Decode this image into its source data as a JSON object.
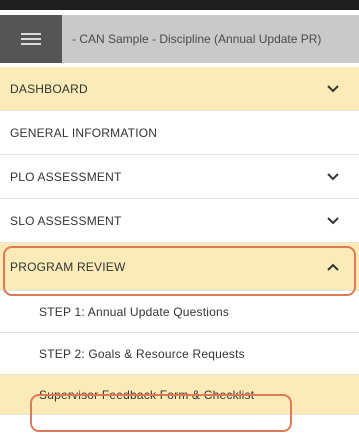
{
  "header": {
    "menu_icon": "hamburger-icon",
    "title": "- CAN Sample - Discipline (Annual Update PR)"
  },
  "nav": {
    "dashboard": {
      "label": "DASHBOARD",
      "icon": "chevron-down-icon"
    },
    "general_information": {
      "label": "GENERAL INFORMATION"
    },
    "plo_assessment": {
      "label": "PLO ASSESSMENT",
      "icon": "chevron-down-icon"
    },
    "slo_assessment": {
      "label": "SLO ASSESSMENT",
      "icon": "chevron-down-icon"
    },
    "program_review": {
      "label": "PROGRAM REVIEW",
      "icon": "chevron-up-icon",
      "expanded": true,
      "items": [
        {
          "label": "STEP 1: Annual Update Questions"
        },
        {
          "label": "STEP 2: Goals & Resource Requests"
        },
        {
          "label": "Supervisor Feedback Form & Checklist",
          "active": true
        }
      ]
    }
  },
  "colors": {
    "highlight": "#faebb8",
    "annotation_outline": "#e07a56",
    "header_bar": "#c9c9c9",
    "menu_button": "#555555"
  }
}
